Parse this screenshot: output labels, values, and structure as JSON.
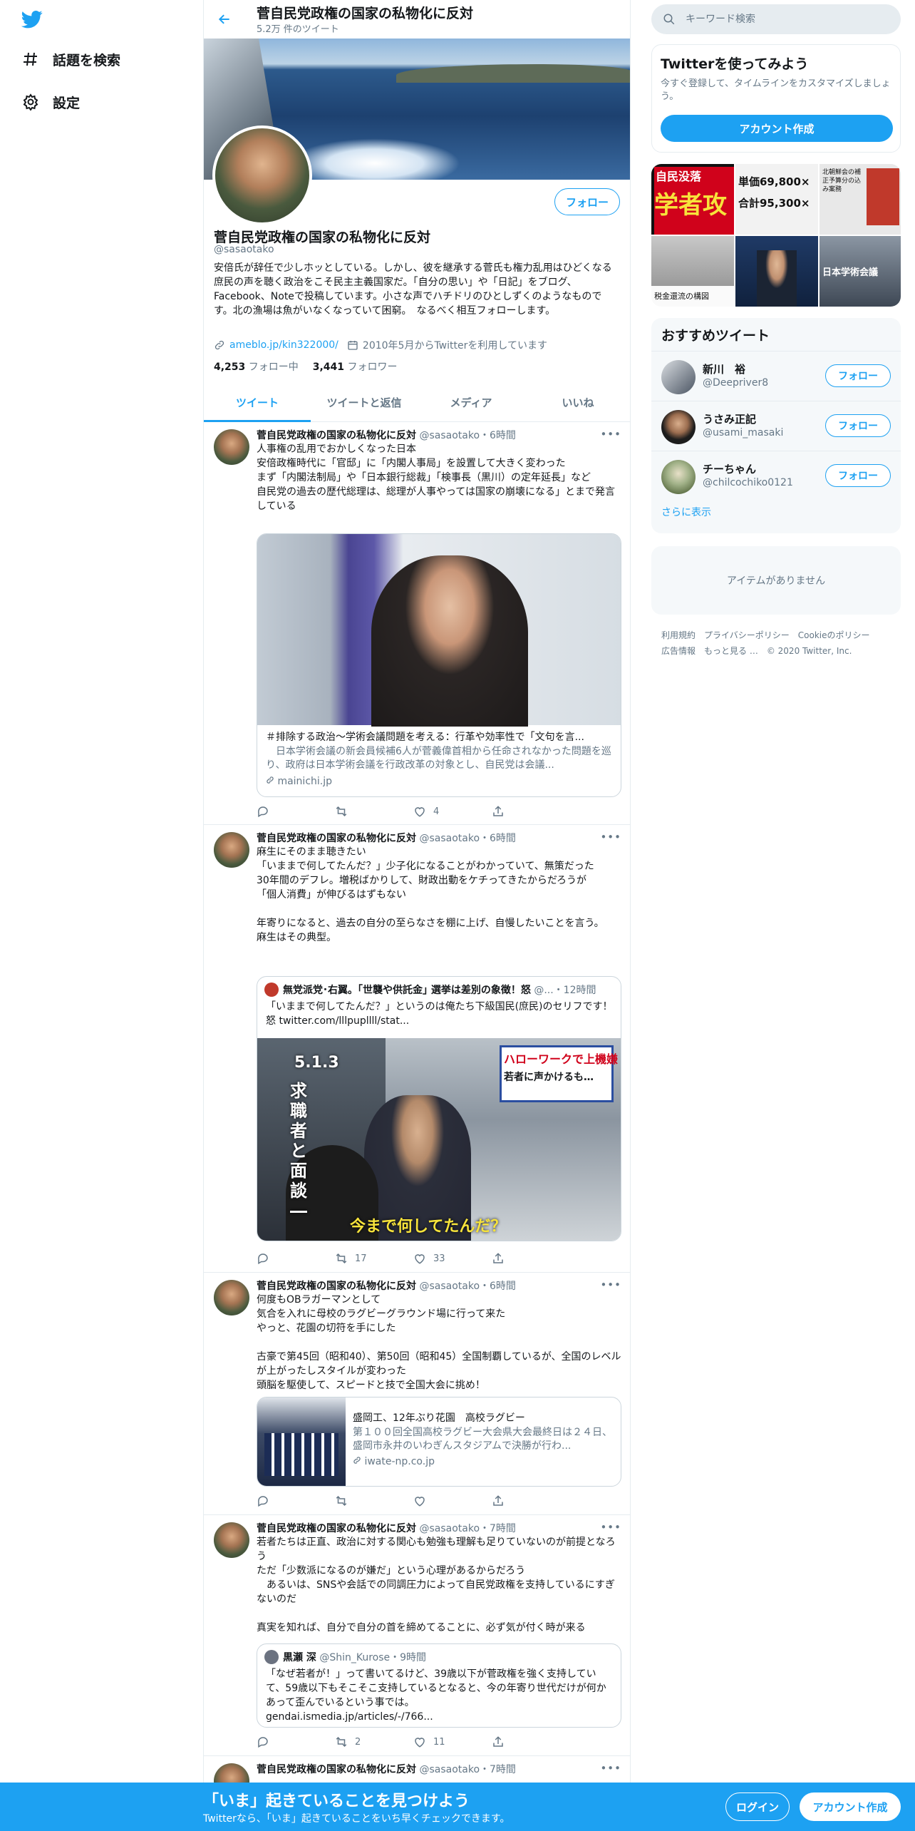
{
  "nav": {
    "explore_label": "話題を検索",
    "settings_label": "設定"
  },
  "profile": {
    "name": "菅自民党政権の国家の私物化に反対",
    "tweet_count": "5.2万 件のツイート",
    "handle": "@sasaotako",
    "follow_label": "フォロー",
    "bio": "安倍氏が辞任で少しホッとしている。しかし、彼を継承する菅氏も権力乱用はひどくなる　庶民の声を聴く政治をこそ民主主義国家だ。「自分の思い」や「日記」をブログ、Facebook、Noteで投稿しています。小さな声でハチドリのひとしずくのようなものです。北の漁場は魚がいなくなっていて困窮。　なるべく相互フォローします。",
    "link": "ameblo.jp/kin322000/",
    "joined": "2010年5月からTwitterを利用しています",
    "following_count": "4,253",
    "following_label": " フォロー中",
    "followers_count": "3,441",
    "followers_label": " フォロワー"
  },
  "tabs": [
    "ツイート",
    "ツイートと返信",
    "メディア",
    "いいね"
  ],
  "tweets": [
    {
      "name": "菅自民党政権の国家の私物化に反対",
      "meta": " @sasaotako・6時間",
      "text": "人事権の乱用でおかしくなった日本\n安倍政権時代に「官邸」に「内閣人事局」を設置して大きく変わった\nまず「内閣法制局」や「日本銀行総裁」「検事長（黒川）の定年延長」など\n自民党の過去の歴代総理は、総理が人事やっては国家の崩壊になる」とまで発言している",
      "card_title": "＃排除する政治～学術会議問題を考える：行革や効率性で「文句を言...",
      "card_desc": "　日本学術会議の新会員候補6人が菅義偉首相から任命されなかった問題を巡り、政府は日本学術会議を行政改革の対象とし、自民党は会議...",
      "card_domain": "mainichi.jp",
      "reply": "",
      "retweet": "",
      "like": "4"
    },
    {
      "name": "菅自民党政権の国家の私物化に反対",
      "meta": " @sasaotako・6時間",
      "text": "麻生にそのまま聴きたい\n「いままで何してたんだ？」少子化になることがわかっていて、無策だった\n30年間のデフレ。増税ばかりして、財政出動をケチってきたからだろうが\n「個人消費」が伸びるはずもない\n\n年寄りになると、過去の自分の至らなさを棚に上げ、自慢したいことを言う。\n麻生はその典型。",
      "quote_name": "無党派党･右翼。｢世襲や供託金｣ 選挙は差別の象徴！怒",
      "quote_meta": " @...・12時間",
      "quote_text": "「いままで何してたんだ？」というのは俺たち下級国民(庶民)のセリフです！怒  twitter.com/lllpupllll/stat...",
      "img_text1": "5.1.3",
      "img_text2": "ハローワークで上機嫌",
      "img_text3": "若者に声かけるも…",
      "img_text4": "求職者と面談―",
      "img_text5": "今まで何してたんだ？",
      "reply": "",
      "retweet": "17",
      "like": "33"
    },
    {
      "name": "菅自民党政権の国家の私物化に反対",
      "meta": " @sasaotako・6時間",
      "text": "何度もOBラガーマンとして\n気合を入れに母校のラグビーグラウンド場に行って来た\nやっと、花園の切符を手にした\n\n古豪で第45回（昭和40）、第50回（昭和45）全国制覇しているが、全国のレベルが上がったしスタイルが変わった\n頭脳を駆使して、スピードと技で全国大会に挑め！",
      "card_title": "盛岡工、12年ぶり花園　高校ラグビー",
      "card_desc": "第１００回全国高校ラグビー大会県大会最終日は２４日、盛岡市永井のいわぎんスタジアムで決勝が行わ...",
      "card_domain": "iwate-np.co.jp",
      "reply": "",
      "retweet": "",
      "like": ""
    },
    {
      "name": "菅自民党政権の国家の私物化に反対",
      "meta": " @sasaotako・7時間",
      "text": "若者たちは正直、政治に対する関心も勉強も理解も足りていないのが前提となろう\nただ「少数派になるのが嫌だ」という心理があるからだろう\n　あるいは、SNSや会話での同調圧力によって自民党政権を支持しているにすぎないのだ\n\n真実を知れば、自分で自分の首を締めてることに、必ず気が付く時が来る",
      "quote_name": "黒瀬 深",
      "quote_meta": " @Shin_Kurose・9時間",
      "quote_text": "「なぜ若者が！」って書いてるけど、39歳以下が菅政権を強く支持していて、59歳以下もそこそこ支持しているとなると、今の年寄り世代だけが何かあって歪んでいるという事では。\ngendai.ismedia.jp/articles/-/766...",
      "reply": "",
      "retweet": "2",
      "like": "11"
    },
    {
      "name": "菅自民党政権の国家の私物化に反対",
      "meta": " @sasaotako・7時間"
    }
  ],
  "right": {
    "search_placeholder": "キーワード検索",
    "signup_title": "Twitterを使ってみよう",
    "signup_text": "今すぐ登録して、タイムラインをカスタマイズしましょう。",
    "signup_button": "アカウント作成",
    "media_text": [
      "自民没落",
      "学者攻",
      "単価69,800×",
      "合計95,300×",
      "北朝鮮会の補正予算分の込み案務",
      "税金還流の構図",
      "日本学術会議"
    ],
    "recs_title": "おすすめツイート",
    "recs": [
      {
        "name": "新川　裕",
        "handle": "@Deepriver8",
        "follow": "フォロー"
      },
      {
        "name": "うさみ正記",
        "handle": "@usami_masaki",
        "follow": "フォロー"
      },
      {
        "name": "チーちゃん",
        "handle": "@chilcochiko0121",
        "follow": "フォロー"
      }
    ],
    "recs_more": "さらに表示",
    "trends_empty": "アイテムがありません",
    "footer": [
      "利用規約",
      "プライバシーポリシー",
      "Cookieのポリシー",
      "広告情報",
      "もっと見る …",
      "© 2020 Twitter, Inc."
    ]
  },
  "bottom": {
    "title": "「いま」起きていることを見つけよう",
    "subtitle": "Twitterなら、「いま」起きていることをいち早くチェックできます。",
    "login": "ログイン",
    "signup": "アカウント作成"
  },
  "colors": {
    "accent": "#1da1f2",
    "text": "#14171a",
    "secondary": "#657786",
    "border": "#e6ecf0"
  }
}
